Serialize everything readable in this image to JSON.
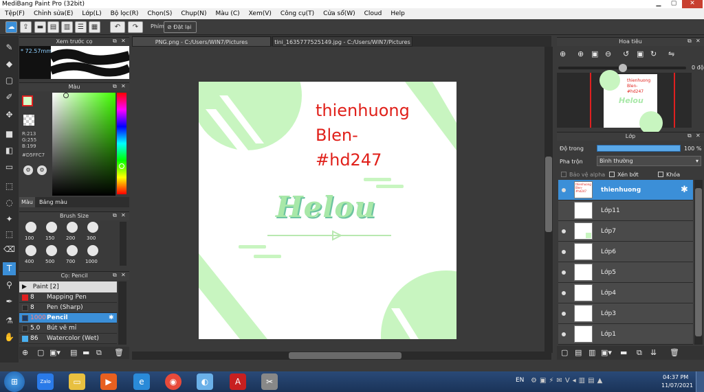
{
  "app": {
    "title": "MediBang Paint Pro (32bit)"
  },
  "menu": [
    "Tệp(F)",
    "Chỉnh sửa(E)",
    "Lớp(L)",
    "Bộ lọc(R)",
    "Chọn(S)",
    "Chụp(N)",
    "Màu (C)",
    "Xem(V)",
    "Công cụ(T)",
    "Cửa sổ(W)",
    "Cloud",
    "Help"
  ],
  "toolbar": {
    "snap_label": "Phím",
    "reset_label": "Đặt lại"
  },
  "preview_panel": {
    "title": "Xem trước cọ",
    "size": "* 72.57mm"
  },
  "color_panel": {
    "title": "Màu",
    "r": "R:213",
    "g": "G:255",
    "b": "B:199",
    "hex": "#D5FFC7",
    "tab_color": "Màu",
    "tab_palette": "Bảng màu",
    "fg_color": "#d5ffc7"
  },
  "brush_size_panel": {
    "title": "Brush Size",
    "sizes": [
      "100",
      "150",
      "200",
      "300",
      "400",
      "500",
      "700",
      "1000"
    ]
  },
  "brush_panel": {
    "title": "Cọ: Pencil",
    "group": "Paint [2]",
    "items": [
      {
        "size": "8",
        "name": "Mapping Pen",
        "swatch": "#e02020"
      },
      {
        "size": "8",
        "name": "Pen (Sharp)",
        "swatch": "#3a3a3a"
      },
      {
        "size": "1000",
        "name": "Pencil",
        "swatch": "#1a3a6a"
      },
      {
        "size": "5.0",
        "name": "Bút vẽ mỉ",
        "swatch": "#3a3a3a"
      },
      {
        "size": "86",
        "name": "Watercolor (Wet)",
        "swatch": "#4ab0f0"
      }
    ]
  },
  "tabs": [
    {
      "label": "PNG.png - C:/Users/WIN7/Pictures"
    },
    {
      "label": "tini_1635777525149.jpg - C:/Users/WIN7/Pictures"
    }
  ],
  "artwork": {
    "text_lines": [
      "thienhuong",
      "Blen-",
      "#hd247"
    ],
    "text_color": "#e0201a",
    "logo_text": "Helou",
    "accent_color": "#c8f5c0"
  },
  "navigator": {
    "title": "Hoa tiêu",
    "angle": "0 độ"
  },
  "layers_panel": {
    "title": "Lớp",
    "opacity_label": "Độ trong",
    "opacity_value": "100 %",
    "blend_label": "Pha trộn",
    "blend_value": "Bình thường",
    "protect_alpha": "Bảo vệ alpha",
    "clipping": "Xén bớt",
    "lock": "Khóa",
    "layers": [
      "thienhuong",
      "Lớp11",
      "Lớp7",
      "Lớp6",
      "Lớp5",
      "Lớp4",
      "Lớp3",
      "Lớp1"
    ]
  },
  "taskbar": {
    "lang": "EN",
    "time": "04:37 PM",
    "date": "11/07/2021"
  }
}
